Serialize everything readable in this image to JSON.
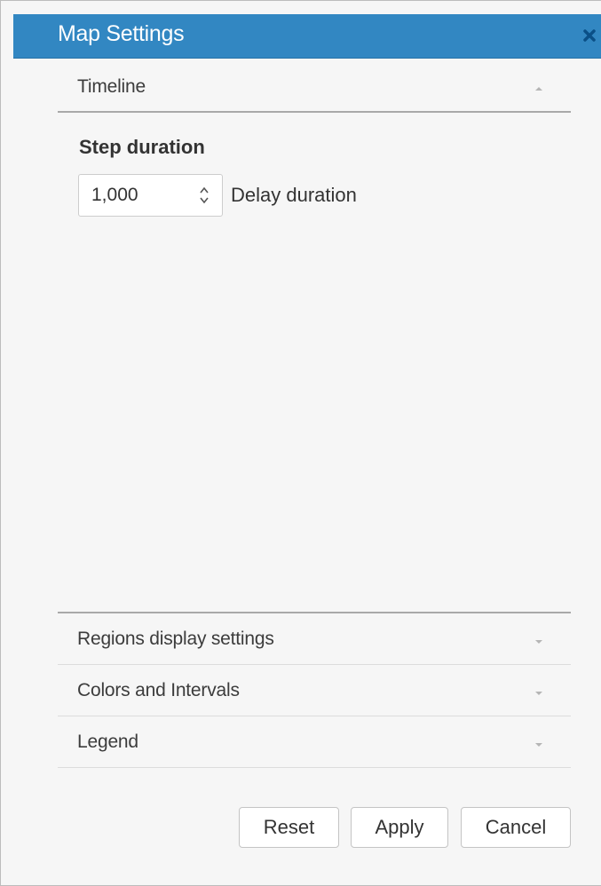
{
  "dialog": {
    "title": "Map Settings",
    "close_icon": "close-icon",
    "accent_color": "#3287c2"
  },
  "sections": {
    "timeline": {
      "label": "Timeline",
      "state": "expanded",
      "step_duration_title": "Step duration",
      "delay_value": "1,000",
      "delay_label": "Delay duration"
    },
    "regions": {
      "label": "Regions display settings",
      "state": "collapsed"
    },
    "colors": {
      "label": "Colors and Intervals",
      "state": "collapsed"
    },
    "legend": {
      "label": "Legend",
      "state": "collapsed"
    }
  },
  "buttons": {
    "reset": "Reset",
    "apply": "Apply",
    "cancel": "Cancel"
  }
}
